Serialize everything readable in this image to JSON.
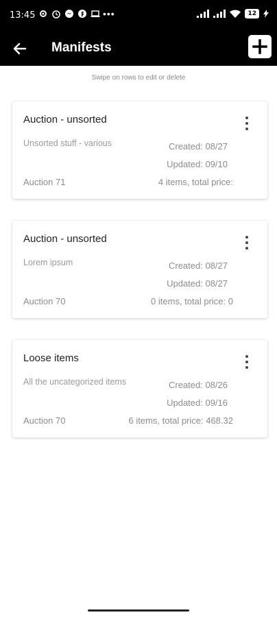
{
  "status_bar": {
    "time": "13:45",
    "left_icons": [
      "gear-icon",
      "alarm-icon",
      "messenger-icon",
      "f-app-icon",
      "laptop-icon"
    ],
    "more": "•••",
    "battery": "12"
  },
  "app_bar": {
    "title": "Manifests",
    "background": "#000000"
  },
  "hint": "Swipe on rows to edit or delete",
  "manifests": [
    {
      "title": "Auction - unsorted",
      "description": "Unsorted stuff - various",
      "created": "Created:  08/27",
      "updated": "Updated:  09/10",
      "auction": "Auction 71",
      "summary": "4 items, total price:"
    },
    {
      "title": "Auction - unsorted",
      "description": "Lorem ipsum",
      "created": "Created:  08/27",
      "updated": "Updated:  08/27",
      "auction": "Auction 70",
      "summary": "0 items, total price: 0"
    },
    {
      "title": "Loose items",
      "description": "All the uncategorized items",
      "created": "Created:  08/26",
      "updated": "Updated:  09/16",
      "auction": "Auction 70",
      "summary": "6 items, total price: 468.32"
    }
  ]
}
